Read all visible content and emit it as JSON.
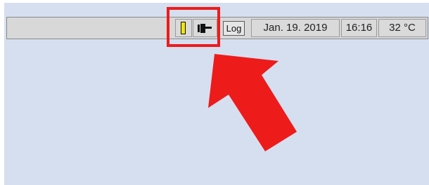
{
  "status_bar": {
    "log_label": "Log",
    "date": "Jan. 19. 2019",
    "time": "16:16",
    "temperature": "32 °C",
    "battery_icon": "battery-level-icon",
    "plug_icon": "power-plug-icon"
  },
  "annotation": {
    "color": "#ee1b1b"
  }
}
